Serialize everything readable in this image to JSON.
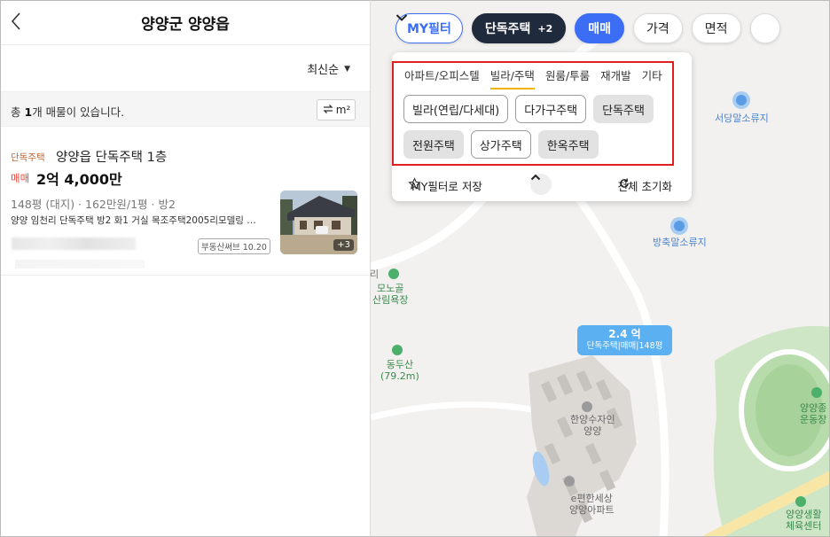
{
  "header": {
    "title": "양양군 양양읍"
  },
  "sort": {
    "label": "최신순"
  },
  "summary": {
    "prefix": "총 ",
    "count": "1",
    "suffix": "개 매물이 있습니다.",
    "unit_toggle": "m²"
  },
  "listings": [
    {
      "type_tag": "단독주택",
      "title": "양양읍 단독주택 1층",
      "deal_type": "매매",
      "price": "2억 4,000만",
      "spec": "148평 (대지) · 162만원/1평 · 방2",
      "description": "양양 임천리 단독주택 방2 화1 거실 목조주택2005리모델링 …",
      "source": "부동산써브 10.20",
      "photo_count": "+3"
    }
  ],
  "filter_bar": {
    "my_filter": "MY필터",
    "property_type": "단독주택",
    "property_type_extra": "+2",
    "deal": "매매",
    "price": "가격",
    "area": "면적"
  },
  "category_tabs": [
    "아파트/오피스텔",
    "빌라/주택",
    "원룸/투룸",
    "재개발",
    "기타"
  ],
  "active_tab_index": 1,
  "sub_types": [
    {
      "label": "빌라(연립/다세대)",
      "selected": false
    },
    {
      "label": "다가구주택",
      "selected": false
    },
    {
      "label": "단독주택",
      "selected": true
    },
    {
      "label": "전원주택",
      "selected": true
    },
    {
      "label": "상가주택",
      "selected": false
    },
    {
      "label": "한옥주택",
      "selected": true
    }
  ],
  "dropdown_footer": {
    "save_label": "MY필터로 저장",
    "reset_label": "전체 초기화"
  },
  "map": {
    "price_marker": {
      "price": "2.4 억",
      "detail": "단독주택|매매|148평"
    },
    "pois": [
      {
        "label": "서당말소류지"
      },
      {
        "label": "방축말소류지"
      },
      {
        "label": "리"
      },
      {
        "label": "모노골\n산림욕장"
      },
      {
        "label": "동두산\n(79.2m)"
      },
      {
        "label": "한양수자인\n양양"
      },
      {
        "label": "e편한세상\n양양아파트"
      },
      {
        "label": "양양종\n운동장"
      },
      {
        "label": "양양생활\n체육센터"
      }
    ]
  },
  "colors": {
    "accent_blue": "#3b6ef5",
    "dark_chip": "#1f2a3d",
    "deal_red": "#e2473a",
    "type_tag": "#c0683a",
    "highlight_box": "#e02020",
    "marker_blue": "#5ab0f0"
  }
}
